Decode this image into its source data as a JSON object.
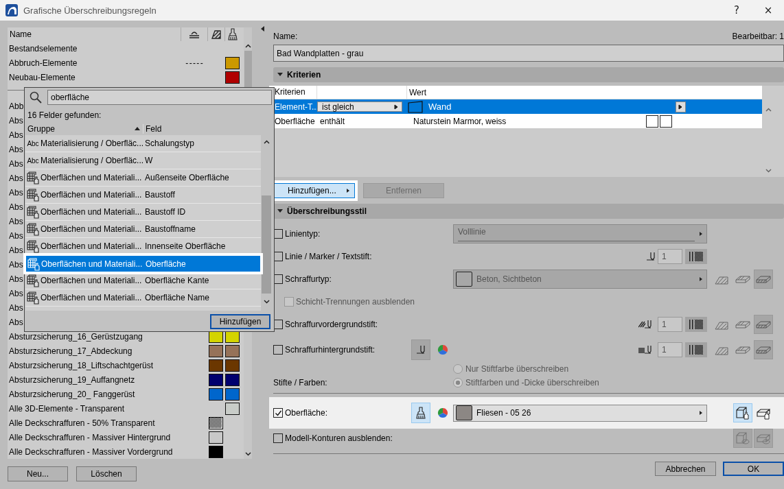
{
  "window": {
    "title": "Grafische Überschreibungsregeln",
    "buttons": [
      "?",
      "×"
    ]
  },
  "rules_list": {
    "header": "Name",
    "sections": [
      {
        "rows": [
          {
            "name": "Bestandselemente"
          },
          {
            "name": "Abbruch-Elemente",
            "line": "- - - - -",
            "surface": {
              "color": "#cc9900"
            }
          },
          {
            "name": "Neubau-Elemente",
            "surface": {
              "color": "#b00000"
            }
          }
        ]
      },
      {
        "rows": [
          {
            "name": "Abb"
          },
          {
            "name": "Abs"
          },
          {
            "name": "Abs"
          },
          {
            "name": "Abs"
          },
          {
            "name": "Abs"
          },
          {
            "name": "Abs"
          },
          {
            "name": "Abs"
          },
          {
            "name": "Abs"
          },
          {
            "name": "Abs"
          },
          {
            "name": "Abs"
          },
          {
            "name": "Abs"
          },
          {
            "name": "Abs"
          },
          {
            "name": "Abs"
          },
          {
            "name": "Abs"
          },
          {
            "name": "Abs"
          },
          {
            "name": "Abs"
          },
          {
            "name": "Absturzsicherung_16_Gerüstzugang",
            "fill": {
              "kind": "solid",
              "color": "#d4d400"
            },
            "surface": {
              "color": "#d4d400"
            }
          },
          {
            "name": "Absturzsicherung_17_Abdeckung",
            "fill": {
              "kind": "solid",
              "color": "#967259"
            },
            "surface": {
              "color": "#967259"
            }
          },
          {
            "name": "Absturzsicherung_18_Liftschachtgerüst",
            "fill": {
              "kind": "solid",
              "color": "#6b3700"
            },
            "surface": {
              "color": "#6b3700"
            }
          },
          {
            "name": "Absturzsicherung_19_Auffangnetz",
            "fill": {
              "kind": "solid",
              "color": "#00006e"
            },
            "surface": {
              "color": "#00006e"
            }
          },
          {
            "name": "Absturzsicherung_20_ Fanggerüst",
            "fill": {
              "kind": "solid",
              "color": "#0066cc"
            },
            "surface": {
              "color": "#0066cc"
            }
          },
          {
            "name": "Alle 3D-Elemente - Transparent",
            "surface": {
              "color": "#c8ccc8"
            }
          },
          {
            "name": "Alle Deckschraffuren - 50% Transparent",
            "fill": {
              "kind": "pattern",
              "color": "#000000"
            }
          },
          {
            "name": "Alle Deckschraffuren - Massiver Hintergrund",
            "fill": {
              "kind": "solid",
              "color": "#c8c8c8"
            }
          },
          {
            "name": "Alle Deckschraffuren - Massiver Vordergrund",
            "fill": {
              "kind": "solid",
              "color": "#000000"
            }
          }
        ]
      }
    ]
  },
  "left_buttons": [
    "Neu...",
    "Löschen"
  ],
  "field_popup": {
    "search": {
      "value": "oberfläche"
    },
    "result_count": "16 Felder gefunden:",
    "columns": [
      "Gruppe",
      "Feld"
    ],
    "rows": [
      {
        "kind": "text",
        "type_label": "Abc",
        "group": "Materialisierung / Oberfläc...",
        "field": "Schalungstyp",
        "selected": false
      },
      {
        "kind": "text",
        "type_label": "Abc",
        "group": "Materialisierung / Oberfläc...",
        "field": "W",
        "selected": false
      },
      {
        "kind": "property",
        "group": "Oberflächen und Materiali...",
        "field": "Außenseite Oberfläche",
        "selected": false
      },
      {
        "kind": "property",
        "group": "Oberflächen und Materiali...",
        "field": "Baustoff",
        "selected": false
      },
      {
        "kind": "property",
        "group": "Oberflächen und Materiali...",
        "field": "Baustoff ID",
        "selected": false
      },
      {
        "kind": "property",
        "group": "Oberflächen und Materiali...",
        "field": "Baustoffname",
        "selected": false
      },
      {
        "kind": "property",
        "group": "Oberflächen und Materiali...",
        "field": "Innenseite Oberfläche",
        "selected": false
      },
      {
        "kind": "property",
        "group": "Oberflächen und Materiali...",
        "field": "Oberfläche",
        "selected": true
      },
      {
        "kind": "property",
        "group": "Oberflächen und Materiali...",
        "field": "Oberfläche Kante",
        "selected": false
      },
      {
        "kind": "property",
        "group": "Oberflächen und Materiali...",
        "field": "Oberfläche Name",
        "selected": false
      }
    ],
    "button": "Hinzufügen"
  },
  "name_label": "Name:",
  "editable": "Bearbeitbar: 1",
  "name_value": "Bad Wandplatten - grau",
  "criteria": {
    "title": "Kriterien",
    "expanded": true,
    "header_criterion": "Kriterien",
    "header_value": "Wert",
    "rows": [
      {
        "kind": "element",
        "criterion": "Element-T...",
        "operator": "ist gleich",
        "value": "Wand",
        "selected": true
      },
      {
        "kind": "surface",
        "criterion": "Oberfläche",
        "operator": "enthält",
        "value": "Naturstein Marmor, weiss",
        "selected": false
      }
    ],
    "add_button": {
      "label": "Hinzufügen...",
      "highlighted": true
    },
    "remove_button": {
      "label": "Entfernen",
      "disabled": true
    }
  },
  "style": {
    "title": "Überschreibungsstil",
    "expanded": true,
    "rows": [
      {
        "kind": "dropdown",
        "label": "Linientyp:",
        "checked": false,
        "value": "Volllinie"
      },
      {
        "kind": "pen",
        "label": "Linie / Marker / Textstift:",
        "checked": false,
        "pen": {
          "kind": "plain",
          "value": "1"
        }
      },
      {
        "kind": "fill",
        "label": "Schraffurtyp:",
        "checked": false,
        "value": "Beton, Sichtbeton",
        "toggles": [
          {
            "selected": false
          },
          {
            "selected": false
          },
          {
            "selected": true
          }
        ]
      },
      {
        "kind": "subcheck",
        "label": "Schicht-Trennungen ausblenden",
        "checked": false
      },
      {
        "kind": "pen",
        "label": "Schraffurvordergrundstift:",
        "checked": false,
        "pen": {
          "kind": "hatch",
          "value": "1"
        },
        "toggles": [
          {
            "selected": false
          },
          {
            "selected": false
          },
          {
            "selected": true
          }
        ]
      },
      {
        "kind": "pen",
        "label": "Schraffurhintergrundstift:",
        "checked": false,
        "pen": {
          "kind": "solid",
          "value": "1"
        },
        "pen_picker": true,
        "toggles": [
          {
            "selected": false
          },
          {
            "selected": false
          },
          {
            "selected": true
          }
        ]
      },
      {
        "kind": "radio",
        "label": "Stifte / Farben:",
        "options": [
          {
            "label": "Nur Stiftfarbe überschreiben",
            "selected": false
          },
          {
            "label": "Stiftfarben und -Dicke überschreiben",
            "selected": true
          }
        ]
      },
      {
        "kind": "surface",
        "label": "Oberfläche:",
        "checked": true,
        "highlighted": true,
        "brush_selected": true,
        "value": "Fliesen - 05 26",
        "swatch": {
          "color": "#8c8784"
        },
        "toggles": [
          {
            "selected": true
          },
          {
            "selected": false
          }
        ]
      },
      {
        "kind": "contours",
        "label": "Modell-Konturen ausblenden:",
        "checked": false,
        "toggles": [
          {
            "selected": true
          },
          {
            "selected": true
          }
        ]
      }
    ]
  },
  "footer": {
    "cancel": "Abbrechen",
    "ok": "OK"
  }
}
